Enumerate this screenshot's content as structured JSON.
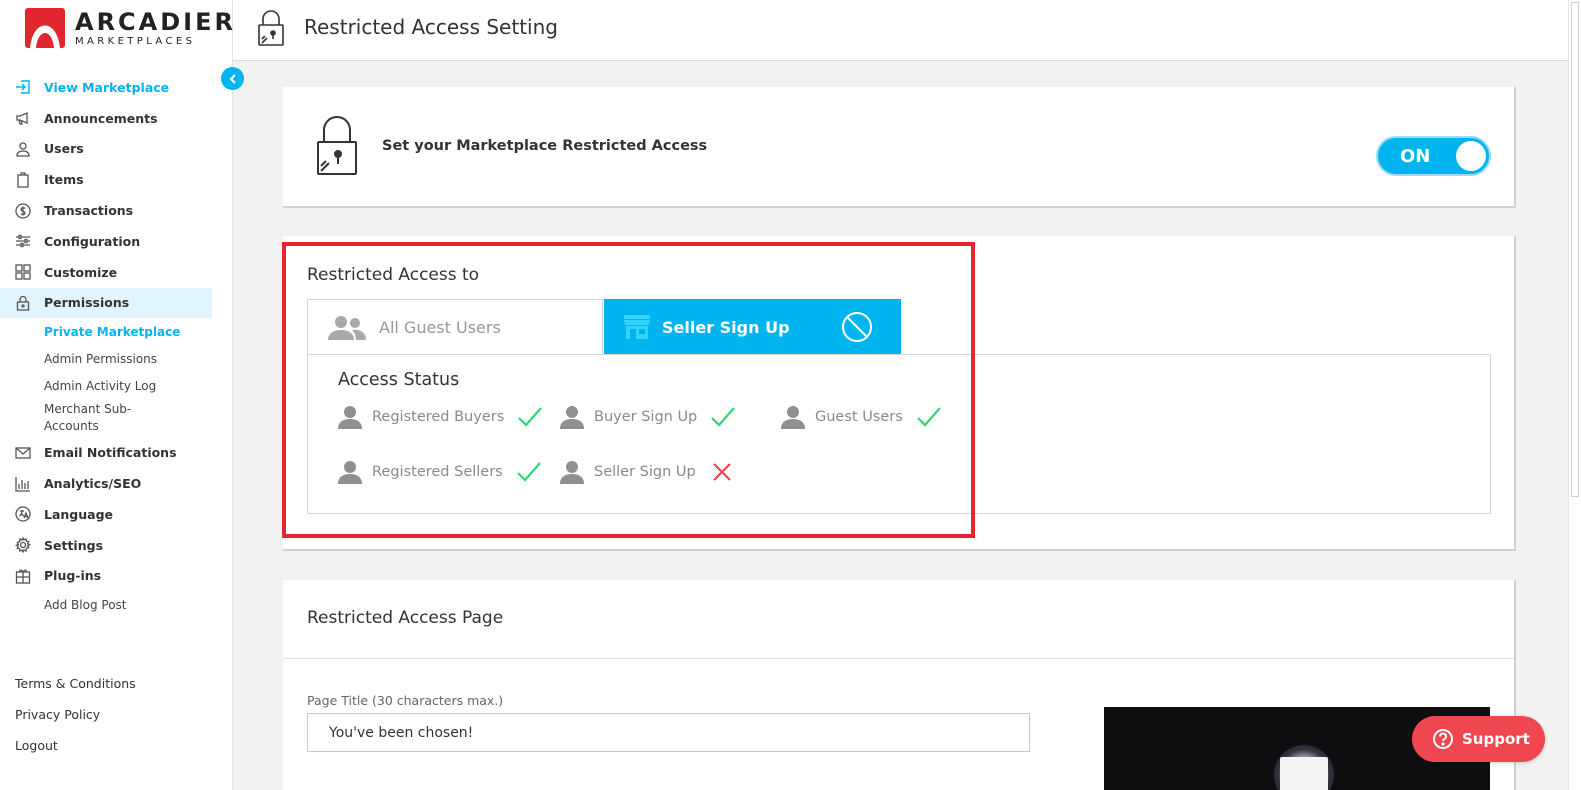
{
  "brand": {
    "name": "ARCADIER",
    "sub": "MARKETPLACES",
    "color": "#e1262d"
  },
  "accent": "#00b5ef",
  "header": {
    "title": "Restricted Access Setting"
  },
  "sidebar": {
    "items": [
      {
        "label": "View Marketplace",
        "icon": "enter-icon"
      },
      {
        "label": "Announcements",
        "icon": "megaphone-icon"
      },
      {
        "label": "Users",
        "icon": "user-icon"
      },
      {
        "label": "Items",
        "icon": "clipboard-icon"
      },
      {
        "label": "Transactions",
        "icon": "dollar-icon"
      },
      {
        "label": "Configuration",
        "icon": "sliders-icon"
      },
      {
        "label": "Customize",
        "icon": "grid-icon"
      },
      {
        "label": "Permissions",
        "icon": "lock-icon"
      }
    ],
    "permissions_sub": [
      "Private Marketplace",
      "Admin Permissions",
      "Admin Activity Log",
      "Merchant Sub-Accounts"
    ],
    "items_after": [
      {
        "label": "Email Notifications",
        "icon": "envelope-icon"
      },
      {
        "label": "Analytics/SEO",
        "icon": "bar-chart-icon"
      },
      {
        "label": "Language",
        "icon": "translate-icon"
      },
      {
        "label": "Settings",
        "icon": "gear-icon"
      },
      {
        "label": "Plug-ins",
        "icon": "plugin-icon"
      }
    ],
    "plugins_sub": [
      "Add Blog Post"
    ],
    "footer": [
      "Terms & Conditions",
      "Privacy Policy",
      "Logout"
    ]
  },
  "restriction": {
    "label": "Set your Marketplace Restricted Access",
    "toggle": "ON"
  },
  "access": {
    "heading": "Restricted Access to",
    "tabs": [
      "All Guest Users",
      "Seller Sign Up"
    ],
    "status_heading": "Access Status",
    "statuses": [
      {
        "label": "Registered Buyers",
        "allowed": true
      },
      {
        "label": "Buyer Sign Up",
        "allowed": true
      },
      {
        "label": "Guest Users",
        "allowed": true
      },
      {
        "label": "Registered Sellers",
        "allowed": true
      },
      {
        "label": "Seller Sign Up",
        "allowed": false
      }
    ]
  },
  "page": {
    "heading": "Restricted Access Page",
    "title_label": "Page Title (30 characters max.)",
    "title_value": "You've been chosen!"
  },
  "support": {
    "label": "Support"
  }
}
